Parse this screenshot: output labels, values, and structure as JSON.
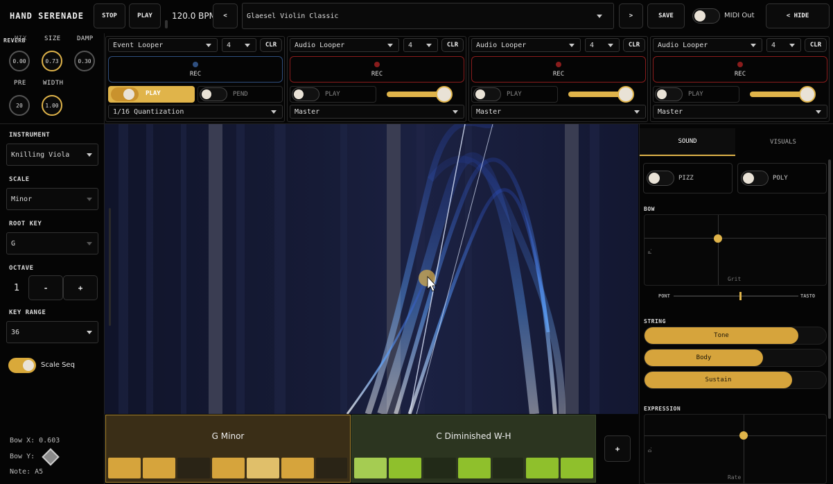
{
  "app": {
    "title": "HAND SERENADE"
  },
  "transport": {
    "stop": "STOP",
    "play": "PLAY",
    "bpm": "120.0 BPM",
    "prev": "<",
    "next": ">",
    "preset": "Glaesel Violin Classic",
    "save": "SAVE",
    "midi_label": "MIDI Out",
    "hide": "< HIDE"
  },
  "reverb": {
    "title": "REVERB",
    "mix_label": "MIX",
    "mix_value": "0.00",
    "size_label": "SIZE",
    "size_value": "0.73",
    "damp_label": "DAMP",
    "damp_value": "0.30",
    "pre_label": "PRE",
    "pre_value": "20",
    "width_label": "WIDTH",
    "width_value": "1.00"
  },
  "loopers": [
    {
      "type": "Event Looper",
      "bars": "4",
      "clr": "CLR",
      "rec": "REC",
      "play": "PLAY",
      "pend": "PEND",
      "route": "1/16 Quantization"
    },
    {
      "type": "Audio Looper",
      "bars": "4",
      "clr": "CLR",
      "rec": "REC",
      "play": "PLAY",
      "route": "Master",
      "level": 0.85
    },
    {
      "type": "Audio Looper",
      "bars": "4",
      "clr": "CLR",
      "rec": "REC",
      "play": "PLAY",
      "route": "Master",
      "level": 0.85
    },
    {
      "type": "Audio Looper",
      "bars": "4",
      "clr": "CLR",
      "rec": "REC",
      "play": "PLAY",
      "route": "Master",
      "level": 0.85
    }
  ],
  "left": {
    "instrument_label": "INSTRUMENT",
    "instrument": "Knilling Viola",
    "scale_label": "SCALE",
    "scale": "Minor",
    "root_label": "ROOT KEY",
    "root": "G",
    "octave_label": "OCTAVE",
    "octave": "1",
    "octave_minus": "-",
    "octave_plus": "+",
    "range_label": "KEY RANGE",
    "range": "36",
    "scale_seq": "Scale Seq",
    "bow_x": "Bow X: 0.603",
    "bow_y": "Bow Y:",
    "note": "Note: A5"
  },
  "scales_bar": {
    "first": "G Minor",
    "second": "C Diminished W-H",
    "add": "+"
  },
  "right": {
    "tab_sound": "SOUND",
    "tab_visuals": "VISUALS",
    "pizz": "PIZZ",
    "poly": "POLY",
    "bow_label": "BOW",
    "bow_axis_x": "Grit",
    "bow_axis_y": "P.",
    "pont": "PONT",
    "tasto": "TASTO",
    "string_label": "STRING",
    "tone": "Tone",
    "tone_level": 0.84,
    "body": "Body",
    "body_level": 0.64,
    "sustain": "Sustain",
    "sustain_level": 0.79,
    "expression_label": "EXPRESSION",
    "expr_axis_x": "Rate",
    "expr_axis_y": "D."
  },
  "colors": {
    "accent": "#e0b44a",
    "panel_bg": "#050505",
    "rec_red": "#8a1c1c",
    "rec_blue": "#2f4f7f",
    "scale_gold": "#3a2e17",
    "scale_green": "#2c3520"
  }
}
